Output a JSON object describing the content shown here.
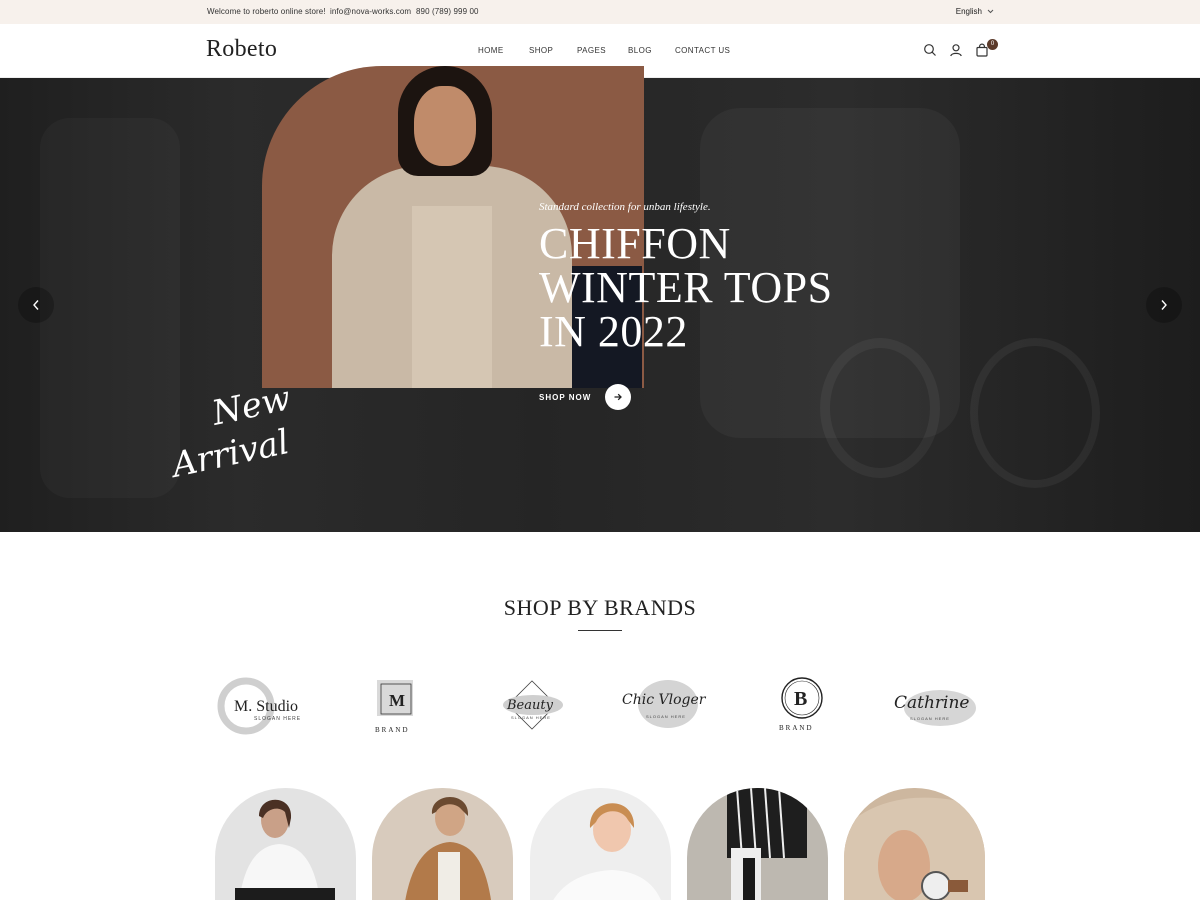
{
  "topbar": {
    "welcome": "Welcome to roberto online store!",
    "email": "info@nova-works.com",
    "phone": "890 (789) 999 00",
    "language": "English"
  },
  "header": {
    "logo": "Robeto",
    "nav": [
      "HOME",
      "SHOP",
      "PAGES",
      "BLOG",
      "CONTACT US"
    ],
    "cart_count": "0",
    "icons": [
      "search-icon",
      "user-icon",
      "cart-icon"
    ]
  },
  "hero": {
    "subtitle": "Standard collection for unban lifestyle.",
    "title_lines": [
      "CHIFFON",
      "WINTER TOPS",
      "IN 2022"
    ],
    "cta": "SHOP NOW",
    "script_text": [
      "New",
      "Arrival"
    ],
    "colors": {
      "arch": "#8b5a44",
      "background": "#262626"
    }
  },
  "brands": {
    "title": "SHOP BY BRANDS",
    "items": [
      {
        "name": "M. Studio",
        "tag": "SLOGAN HERE"
      },
      {
        "name": "M",
        "tag": "BRAND"
      },
      {
        "name": "Beauty",
        "tag": "SLOGAN HERE"
      },
      {
        "name": "Chic Vloger",
        "tag": "SLOGAN HERE"
      },
      {
        "name": "B",
        "tag": "BRAND"
      },
      {
        "name": "Cathrine",
        "tag": "SLOGAN HERE"
      }
    ]
  }
}
